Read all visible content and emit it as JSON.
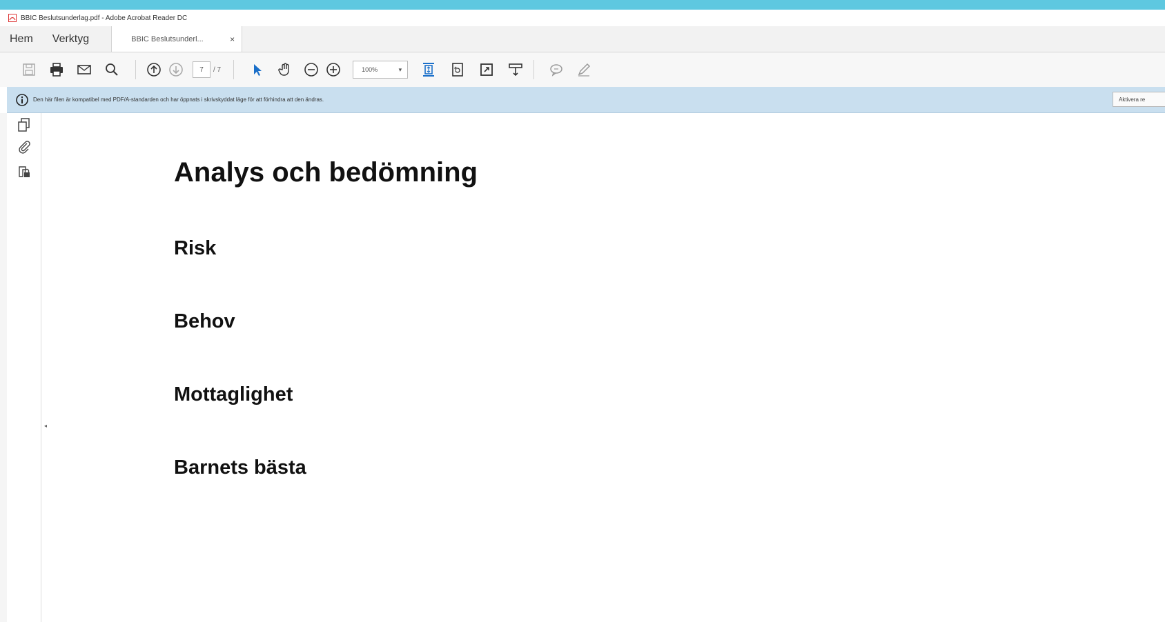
{
  "window": {
    "title": "BBIC Beslutsunderlag.pdf - Adobe Acrobat Reader DC",
    "accent_color": "#5ec8e0"
  },
  "tabs": {
    "home_label": "Hem",
    "tools_label": "Verktyg",
    "document_tab_label": "BBIC Beslutsunderl...",
    "close_glyph": "×"
  },
  "toolbar": {
    "page_current": "7",
    "page_total": "/ 7",
    "zoom_value": "100%",
    "zoom_chevron": "▾",
    "icons": [
      "save-icon",
      "print-icon",
      "email-icon",
      "search-icon",
      "page-up-icon",
      "page-down-icon",
      "select-arrow-icon",
      "hand-tool-icon",
      "zoom-out-icon",
      "zoom-in-icon",
      "fit-page-icon",
      "rotate-icon",
      "fullscreen-icon",
      "read-mode-icon",
      "comment-icon",
      "sign-icon"
    ]
  },
  "infobar": {
    "message": "Den här filen är kompatibel med PDF/A-standarden och har öppnats i skrivskyddat läge för att förhindra att den ändras.",
    "button_label": "Aktivera re",
    "background": "#c9dfef"
  },
  "sidebar": {
    "icons": [
      "page-thumbnails-icon",
      "attachments-icon",
      "bookmark-lock-icon"
    ],
    "collapse_glyph": "◂"
  },
  "document": {
    "heading": "Analys och bedömning",
    "sections": [
      "Risk",
      "Behov",
      "Mottaglighet",
      "Barnets bästa"
    ]
  }
}
